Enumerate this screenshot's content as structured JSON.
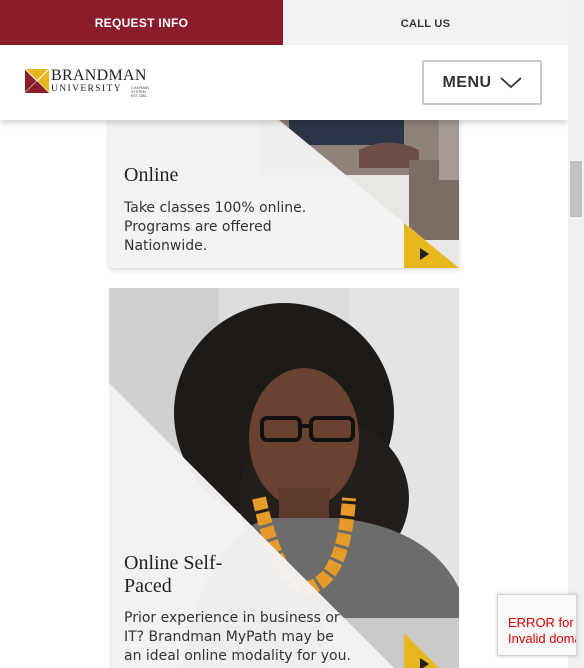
{
  "topbar": {
    "request_info": "REQUEST INFO",
    "call_us": "CALL US"
  },
  "header": {
    "logo_line1": "BRANDMAN",
    "logo_line2": "UNIVERSITY",
    "logo_small": "CHAPMAN SYSTEM EST 1861",
    "menu_label": "MENU"
  },
  "colors": {
    "brand": "#8a1c2b",
    "accent": "#e6b81e"
  },
  "cards": [
    {
      "title": "Online",
      "text_lines": [
        "Take classes 100% online.",
        "Programs are offered",
        "Nationwide."
      ],
      "icon": "play-arrow-icon"
    },
    {
      "title_lines": [
        "Online Self-",
        "Paced"
      ],
      "text_lines": [
        "Prior experience in business or",
        "IT? Brandman MyPath may be",
        "an ideal online modality for you."
      ],
      "icon": "play-arrow-icon"
    }
  ],
  "recaptcha": {
    "line1": "ERROR for site owner:",
    "line2": "Invalid domain for site key"
  }
}
